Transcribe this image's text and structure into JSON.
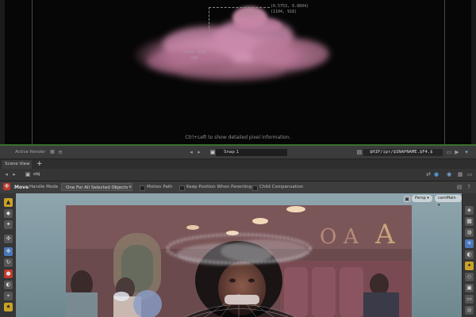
{
  "render_view": {
    "pixel_uv": "(0.5753, 0.8604)",
    "pixel_xy": "(1104, 918)",
    "center_line1": "(1104, 918)",
    "center_line2": "rgb",
    "hint": "Ctrl+Left to show detailed pixel information."
  },
  "render_toolbar": {
    "active_render": "Active Render",
    "snap_name": "Snap 1",
    "snap_path": "$HIP/ipr/$SNAPNAME.$F4.$"
  },
  "pane_tabs": {
    "active_tab": "Scene View",
    "add_label": "+"
  },
  "path_bar": {
    "path": "obj"
  },
  "tool_options": {
    "tool_name": "Move",
    "handle_mode_label": "Handle Mode",
    "handle_mode_value": "One For All Selected Objects",
    "motion_path": "Motion Path",
    "keep_position": "Keep Position When Parenting",
    "child_comp": "Child Compensation"
  },
  "viewport": {
    "persp": "Persp",
    "camera": "camMain"
  },
  "icons": {
    "arrow_down": "▾",
    "gear": "⚙",
    "camera": "▣"
  }
}
